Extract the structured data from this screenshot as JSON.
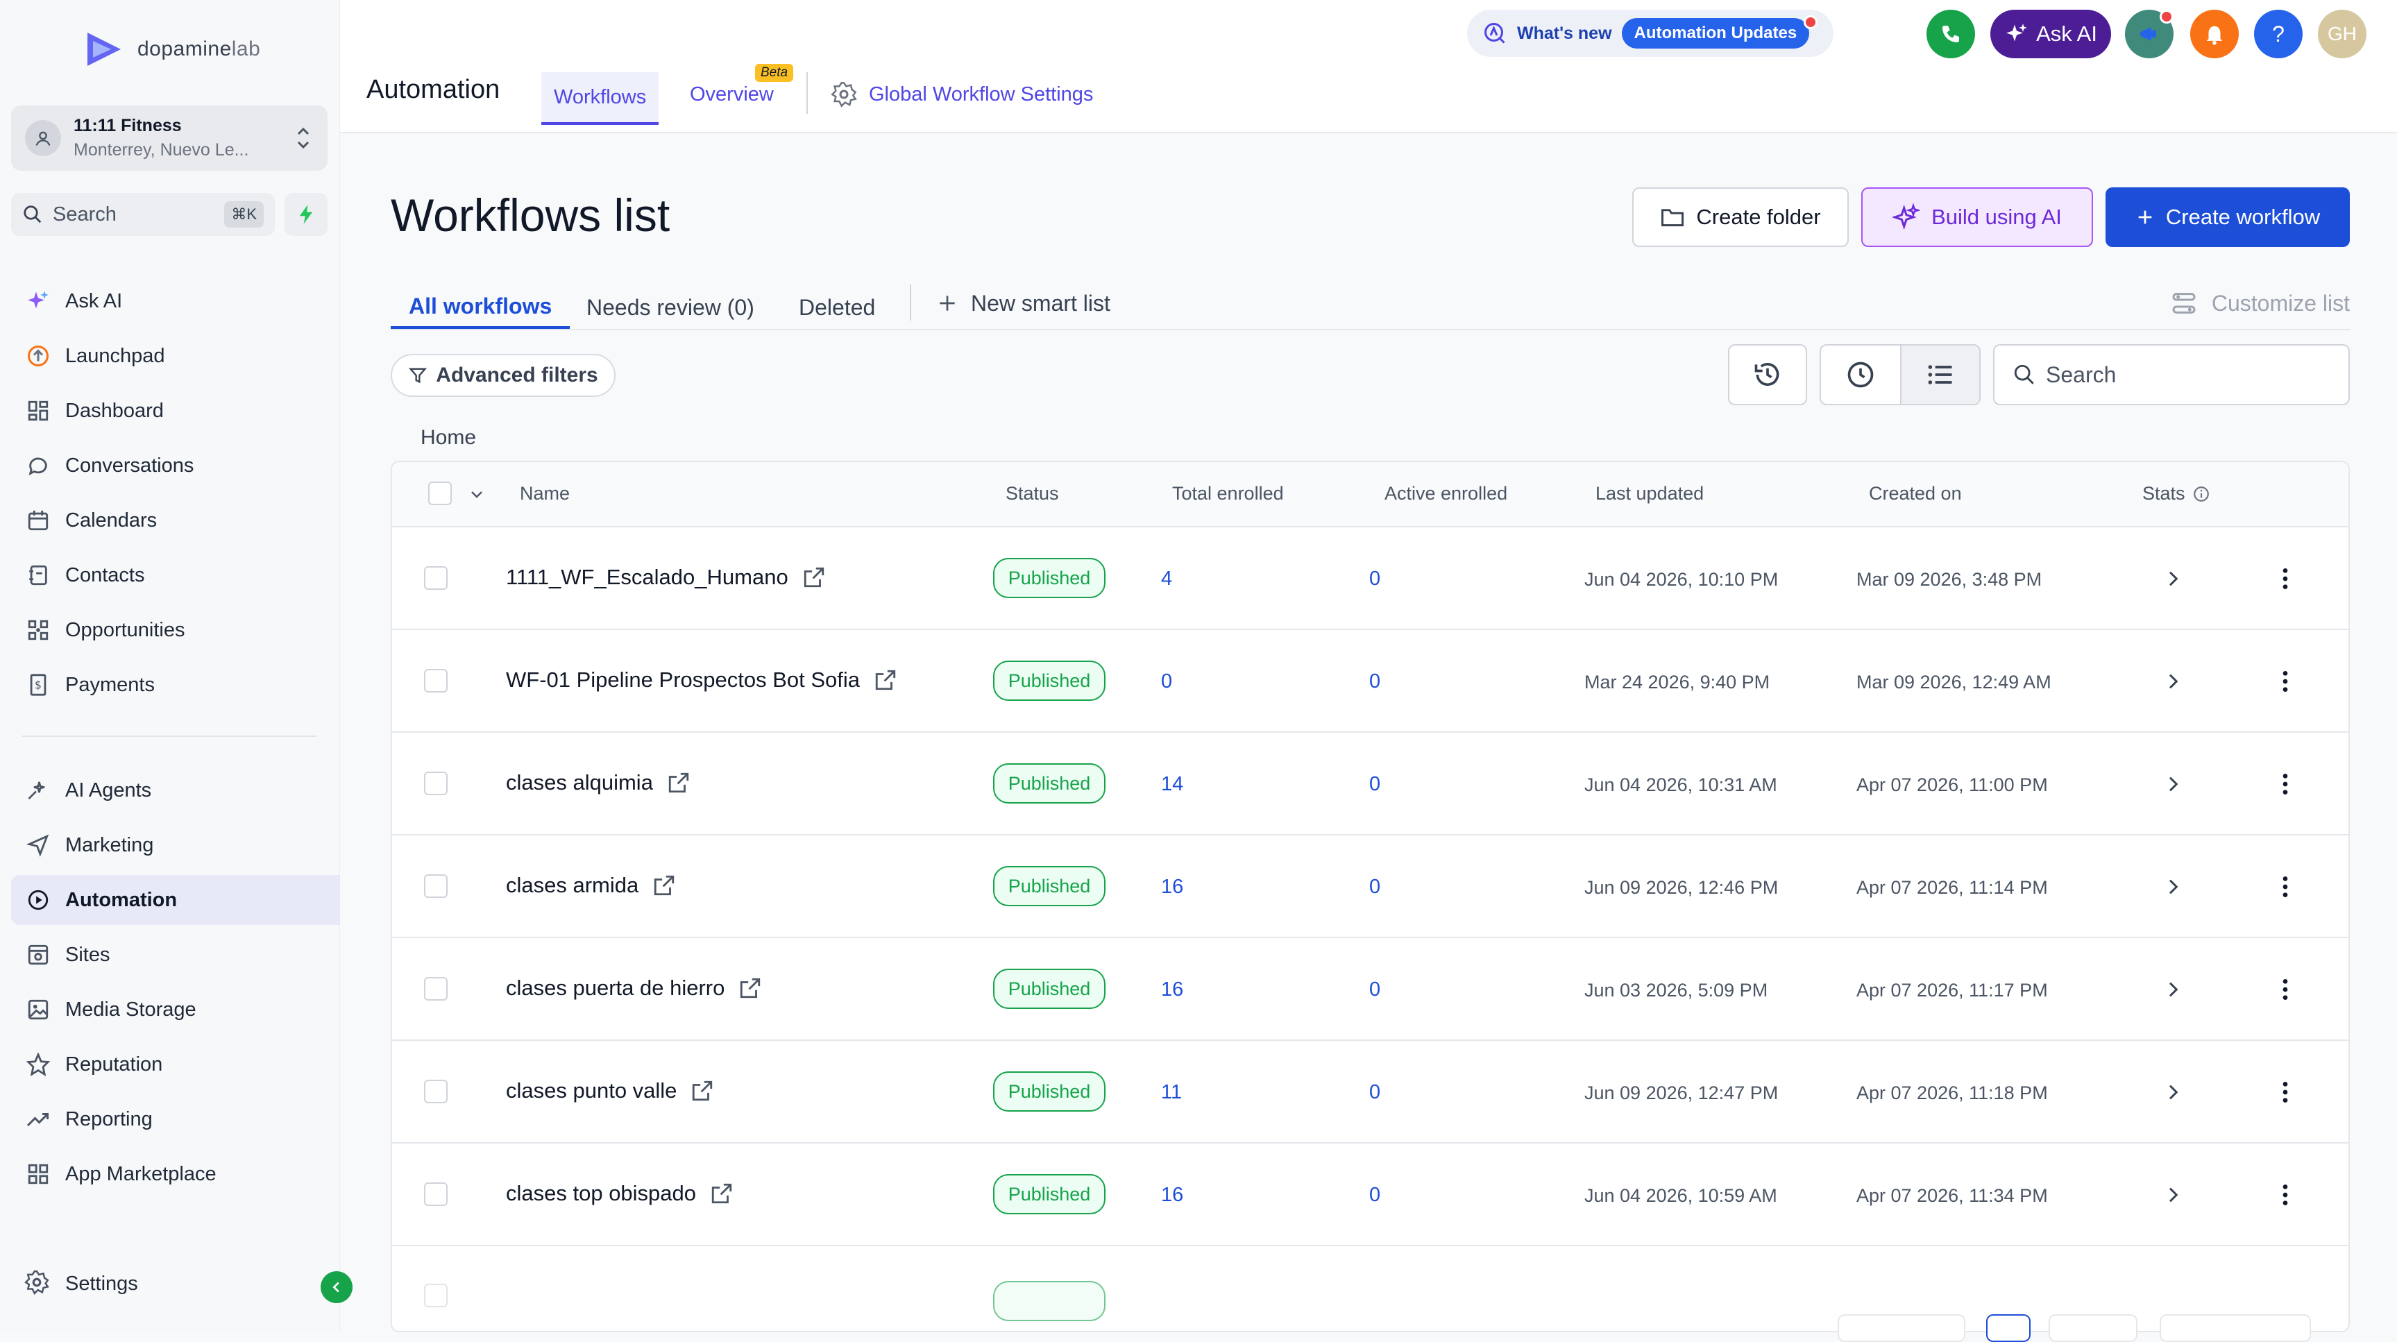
{
  "brand": {
    "name_main": "dopamine",
    "name_suffix": "lab"
  },
  "account": {
    "name": "11:11 Fitness",
    "location": "Monterrey, Nuevo Le..."
  },
  "sidebar_search": {
    "label": "Search",
    "shortcut": "⌘K"
  },
  "sidebar": {
    "items": [
      {
        "label": "Ask AI"
      },
      {
        "label": "Launchpad"
      },
      {
        "label": "Dashboard"
      },
      {
        "label": "Conversations"
      },
      {
        "label": "Calendars"
      },
      {
        "label": "Contacts"
      },
      {
        "label": "Opportunities"
      },
      {
        "label": "Payments"
      }
    ],
    "items2": [
      {
        "label": "AI Agents"
      },
      {
        "label": "Marketing"
      },
      {
        "label": "Automation"
      },
      {
        "label": "Sites"
      },
      {
        "label": "Media Storage"
      },
      {
        "label": "Reputation"
      },
      {
        "label": "Reporting"
      },
      {
        "label": "App Marketplace"
      }
    ],
    "settings": "Settings"
  },
  "header": {
    "module": "Automation",
    "tabs": {
      "workflows": "Workflows",
      "overview": "Overview",
      "beta": "Beta",
      "global": "Global Workflow Settings"
    },
    "whats_new": "What's new",
    "updates": "Automation Updates",
    "ask_ai": "Ask AI",
    "help": "?",
    "avatar": "GH"
  },
  "page": {
    "title": "Workflows list",
    "buttons": {
      "folder": "Create folder",
      "ai": "Build using AI",
      "create": "Create workflow"
    },
    "subtabs": {
      "all": "All workflows",
      "review": "Needs review (0)",
      "deleted": "Deleted",
      "smart": "New smart list",
      "customize": "Customize list"
    },
    "adv_filters": "Advanced filters",
    "search_placeholder": "Search",
    "breadcrumb": "Home"
  },
  "table": {
    "headers": {
      "name": "Name",
      "status": "Status",
      "total": "Total enrolled",
      "active": "Active enrolled",
      "updated": "Last updated",
      "created": "Created on",
      "stats": "Stats"
    },
    "rows": [
      {
        "name": "1111_WF_Escalado_Humano",
        "status": "Published",
        "total": "4",
        "active": "0",
        "updated": "Jun 04 2026, 10:10 PM",
        "created": "Mar 09 2026, 3:48 PM"
      },
      {
        "name": "WF-01 Pipeline Prospectos Bot Sofia",
        "status": "Published",
        "total": "0",
        "active": "0",
        "updated": "Mar 24 2026, 9:40 PM",
        "created": "Mar 09 2026, 12:49 AM"
      },
      {
        "name": "clases alquimia",
        "status": "Published",
        "total": "14",
        "active": "0",
        "updated": "Jun 04 2026, 10:31 AM",
        "created": "Apr 07 2026, 11:00 PM"
      },
      {
        "name": "clases armida",
        "status": "Published",
        "total": "16",
        "active": "0",
        "updated": "Jun 09 2026, 12:46 PM",
        "created": "Apr 07 2026, 11:14 PM"
      },
      {
        "name": "clases puerta de hierro",
        "status": "Published",
        "total": "16",
        "active": "0",
        "updated": "Jun 03 2026, 5:09 PM",
        "created": "Apr 07 2026, 11:17 PM"
      },
      {
        "name": "clases punto valle",
        "status": "Published",
        "total": "11",
        "active": "0",
        "updated": "Jun 09 2026, 12:47 PM",
        "created": "Apr 07 2026, 11:18 PM"
      },
      {
        "name": "clases top obispado",
        "status": "Published",
        "total": "16",
        "active": "0",
        "updated": "Jun 04 2026, 10:59 AM",
        "created": "Apr 07 2026, 11:34 PM"
      }
    ]
  },
  "colors": {
    "accent": "#4f46e5",
    "primary": "#1d4ed8",
    "success": "#16a34a",
    "ai_purple": "#6d28d9"
  }
}
